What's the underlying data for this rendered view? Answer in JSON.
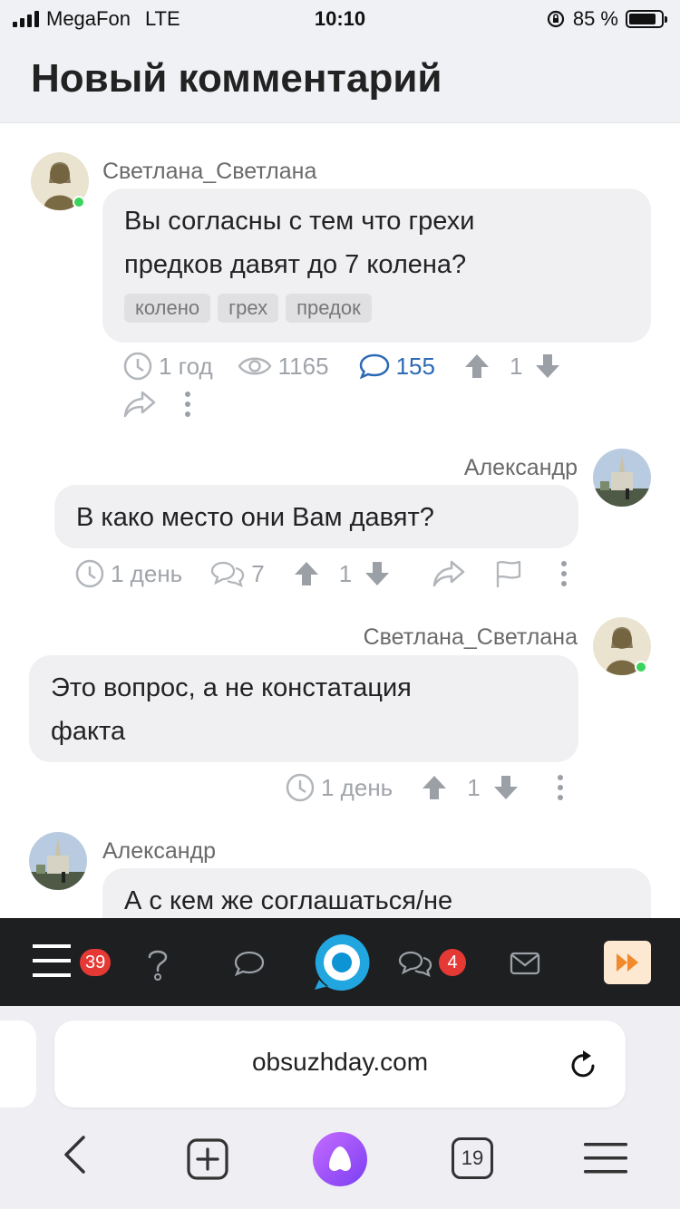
{
  "status_bar": {
    "carrier": "MegaFon",
    "network": "LTE",
    "time": "10:10",
    "battery": "85 %",
    "battery_level": 0.85
  },
  "header": {
    "title": "Новый комментарий"
  },
  "comments": [
    {
      "author": "Светлана_Светлана",
      "text_lines": [
        "Вы согласны с тем что грехи",
        "предков давят до 7 колена?"
      ],
      "tags": [
        "колено",
        "грех",
        "предок"
      ],
      "time": "1 год",
      "views": "1165",
      "answers": "155",
      "rating": "1",
      "online": true
    },
    {
      "author": "Александр",
      "text_lines": [
        "В како место они Вам давят?"
      ],
      "time": "1 день",
      "answers": "7",
      "rating": "1"
    },
    {
      "author": "Светлана_Светлана",
      "text_lines": [
        "Это вопрос, а не констатация",
        "факта"
      ],
      "time": "1 день",
      "rating": "1",
      "online": true
    },
    {
      "author": "Александр",
      "text_lines": [
        "А с кем же соглашаться/не"
      ]
    }
  ],
  "app_bar": {
    "menu_badge": "39",
    "messages_badge": "4"
  },
  "browser": {
    "url": "obsuzhday.com",
    "tabs_count": "19"
  },
  "colors": {
    "accent_blue": "#2b6ab5",
    "badge_red": "#e53935",
    "online_green": "#3bd45b",
    "alice_purple": "#a855f7"
  }
}
